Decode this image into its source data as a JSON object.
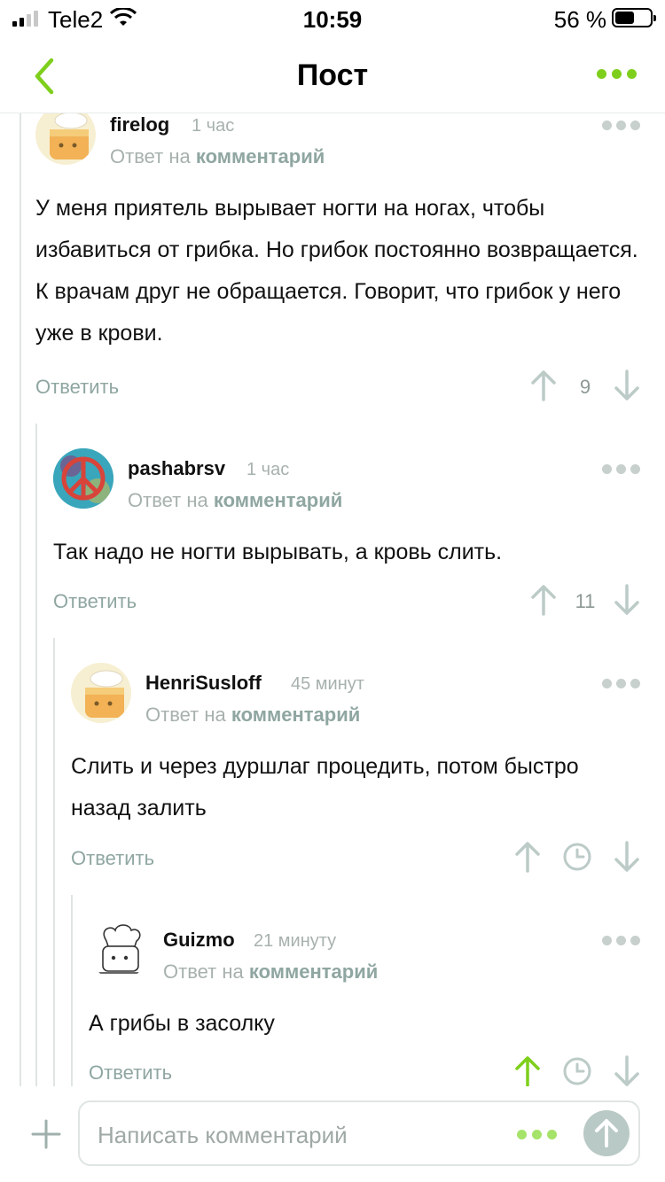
{
  "status_bar": {
    "carrier": "Tele2",
    "time": "10:59",
    "battery": "56 %",
    "battery_level": 0.56
  },
  "nav": {
    "title": "Пост"
  },
  "icons": {
    "back": "chevron-left-icon",
    "more": "more-dots-icon",
    "up": "arrow-up-icon",
    "down": "arrow-down-icon",
    "pending": "clock-icon"
  },
  "colors": {
    "accent_green": "#7ecf1c",
    "muted_link": "#8fa6a1",
    "muted_text": "#a7b1ae"
  },
  "reply_label": "Ответить",
  "reply_prefix": "Ответ на",
  "reply_link": "комментарий",
  "comments": [
    {
      "author": "firelog",
      "time": "1 час",
      "text": "У меня приятель вырывает ногти на ногах, чтобы избавиться от грибка. Но грибок постоянно возвращается. К врачам друг не обращается. Говорит, что грибок у него уже в крови.",
      "score": "9"
    },
    {
      "author": "pashabrsv",
      "time": "1 час",
      "text": "Так надо не ногти вырывать, а кровь слить.",
      "score": "11"
    },
    {
      "author": "HenriSusloff",
      "time": "45 минут",
      "text": "Слить и через дуршлаг процедить, потом быстро назад залить",
      "score": ""
    },
    {
      "author": "Guizmo",
      "time": "21 минуту",
      "text": "А грибы в засолку",
      "score": ""
    }
  ],
  "composer": {
    "placeholder": "Написать комментарий"
  }
}
